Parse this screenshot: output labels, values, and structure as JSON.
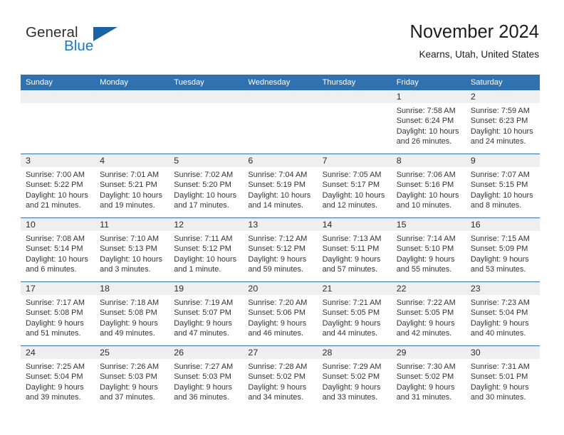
{
  "brand": {
    "name_part1": "General",
    "name_part2": "Blue",
    "triangle_color": "#1763a5",
    "blue_color": "#1a7ac4"
  },
  "header": {
    "title": "November 2024",
    "location": "Kearns, Utah, United States",
    "header_bg_color": "#3071b0",
    "daynum_band_color": "#efefef"
  },
  "weekday_headers": [
    "Sunday",
    "Monday",
    "Tuesday",
    "Wednesday",
    "Thursday",
    "Friday",
    "Saturday"
  ],
  "weeks": [
    {
      "days": [
        {
          "num": "",
          "empty": true,
          "sunrise": "",
          "sunset": "",
          "daylight_line1": "",
          "daylight_line2": ""
        },
        {
          "num": "",
          "empty": true,
          "sunrise": "",
          "sunset": "",
          "daylight_line1": "",
          "daylight_line2": ""
        },
        {
          "num": "",
          "empty": true,
          "sunrise": "",
          "sunset": "",
          "daylight_line1": "",
          "daylight_line2": ""
        },
        {
          "num": "",
          "empty": true,
          "sunrise": "",
          "sunset": "",
          "daylight_line1": "",
          "daylight_line2": ""
        },
        {
          "num": "",
          "empty": true,
          "sunrise": "",
          "sunset": "",
          "daylight_line1": "",
          "daylight_line2": ""
        },
        {
          "num": "1",
          "empty": false,
          "sunrise": "Sunrise: 7:58 AM",
          "sunset": "Sunset: 6:24 PM",
          "daylight_line1": "Daylight: 10 hours",
          "daylight_line2": "and 26 minutes."
        },
        {
          "num": "2",
          "empty": false,
          "sunrise": "Sunrise: 7:59 AM",
          "sunset": "Sunset: 6:23 PM",
          "daylight_line1": "Daylight: 10 hours",
          "daylight_line2": "and 24 minutes."
        }
      ]
    },
    {
      "days": [
        {
          "num": "3",
          "empty": false,
          "sunrise": "Sunrise: 7:00 AM",
          "sunset": "Sunset: 5:22 PM",
          "daylight_line1": "Daylight: 10 hours",
          "daylight_line2": "and 21 minutes."
        },
        {
          "num": "4",
          "empty": false,
          "sunrise": "Sunrise: 7:01 AM",
          "sunset": "Sunset: 5:21 PM",
          "daylight_line1": "Daylight: 10 hours",
          "daylight_line2": "and 19 minutes."
        },
        {
          "num": "5",
          "empty": false,
          "sunrise": "Sunrise: 7:02 AM",
          "sunset": "Sunset: 5:20 PM",
          "daylight_line1": "Daylight: 10 hours",
          "daylight_line2": "and 17 minutes."
        },
        {
          "num": "6",
          "empty": false,
          "sunrise": "Sunrise: 7:04 AM",
          "sunset": "Sunset: 5:19 PM",
          "daylight_line1": "Daylight: 10 hours",
          "daylight_line2": "and 14 minutes."
        },
        {
          "num": "7",
          "empty": false,
          "sunrise": "Sunrise: 7:05 AM",
          "sunset": "Sunset: 5:17 PM",
          "daylight_line1": "Daylight: 10 hours",
          "daylight_line2": "and 12 minutes."
        },
        {
          "num": "8",
          "empty": false,
          "sunrise": "Sunrise: 7:06 AM",
          "sunset": "Sunset: 5:16 PM",
          "daylight_line1": "Daylight: 10 hours",
          "daylight_line2": "and 10 minutes."
        },
        {
          "num": "9",
          "empty": false,
          "sunrise": "Sunrise: 7:07 AM",
          "sunset": "Sunset: 5:15 PM",
          "daylight_line1": "Daylight: 10 hours",
          "daylight_line2": "and 8 minutes."
        }
      ]
    },
    {
      "days": [
        {
          "num": "10",
          "empty": false,
          "sunrise": "Sunrise: 7:08 AM",
          "sunset": "Sunset: 5:14 PM",
          "daylight_line1": "Daylight: 10 hours",
          "daylight_line2": "and 6 minutes."
        },
        {
          "num": "11",
          "empty": false,
          "sunrise": "Sunrise: 7:10 AM",
          "sunset": "Sunset: 5:13 PM",
          "daylight_line1": "Daylight: 10 hours",
          "daylight_line2": "and 3 minutes."
        },
        {
          "num": "12",
          "empty": false,
          "sunrise": "Sunrise: 7:11 AM",
          "sunset": "Sunset: 5:12 PM",
          "daylight_line1": "Daylight: 10 hours",
          "daylight_line2": "and 1 minute."
        },
        {
          "num": "13",
          "empty": false,
          "sunrise": "Sunrise: 7:12 AM",
          "sunset": "Sunset: 5:12 PM",
          "daylight_line1": "Daylight: 9 hours",
          "daylight_line2": "and 59 minutes."
        },
        {
          "num": "14",
          "empty": false,
          "sunrise": "Sunrise: 7:13 AM",
          "sunset": "Sunset: 5:11 PM",
          "daylight_line1": "Daylight: 9 hours",
          "daylight_line2": "and 57 minutes."
        },
        {
          "num": "15",
          "empty": false,
          "sunrise": "Sunrise: 7:14 AM",
          "sunset": "Sunset: 5:10 PM",
          "daylight_line1": "Daylight: 9 hours",
          "daylight_line2": "and 55 minutes."
        },
        {
          "num": "16",
          "empty": false,
          "sunrise": "Sunrise: 7:15 AM",
          "sunset": "Sunset: 5:09 PM",
          "daylight_line1": "Daylight: 9 hours",
          "daylight_line2": "and 53 minutes."
        }
      ]
    },
    {
      "days": [
        {
          "num": "17",
          "empty": false,
          "sunrise": "Sunrise: 7:17 AM",
          "sunset": "Sunset: 5:08 PM",
          "daylight_line1": "Daylight: 9 hours",
          "daylight_line2": "and 51 minutes."
        },
        {
          "num": "18",
          "empty": false,
          "sunrise": "Sunrise: 7:18 AM",
          "sunset": "Sunset: 5:08 PM",
          "daylight_line1": "Daylight: 9 hours",
          "daylight_line2": "and 49 minutes."
        },
        {
          "num": "19",
          "empty": false,
          "sunrise": "Sunrise: 7:19 AM",
          "sunset": "Sunset: 5:07 PM",
          "daylight_line1": "Daylight: 9 hours",
          "daylight_line2": "and 47 minutes."
        },
        {
          "num": "20",
          "empty": false,
          "sunrise": "Sunrise: 7:20 AM",
          "sunset": "Sunset: 5:06 PM",
          "daylight_line1": "Daylight: 9 hours",
          "daylight_line2": "and 46 minutes."
        },
        {
          "num": "21",
          "empty": false,
          "sunrise": "Sunrise: 7:21 AM",
          "sunset": "Sunset: 5:05 PM",
          "daylight_line1": "Daylight: 9 hours",
          "daylight_line2": "and 44 minutes."
        },
        {
          "num": "22",
          "empty": false,
          "sunrise": "Sunrise: 7:22 AM",
          "sunset": "Sunset: 5:05 PM",
          "daylight_line1": "Daylight: 9 hours",
          "daylight_line2": "and 42 minutes."
        },
        {
          "num": "23",
          "empty": false,
          "sunrise": "Sunrise: 7:23 AM",
          "sunset": "Sunset: 5:04 PM",
          "daylight_line1": "Daylight: 9 hours",
          "daylight_line2": "and 40 minutes."
        }
      ]
    },
    {
      "days": [
        {
          "num": "24",
          "empty": false,
          "sunrise": "Sunrise: 7:25 AM",
          "sunset": "Sunset: 5:04 PM",
          "daylight_line1": "Daylight: 9 hours",
          "daylight_line2": "and 39 minutes."
        },
        {
          "num": "25",
          "empty": false,
          "sunrise": "Sunrise: 7:26 AM",
          "sunset": "Sunset: 5:03 PM",
          "daylight_line1": "Daylight: 9 hours",
          "daylight_line2": "and 37 minutes."
        },
        {
          "num": "26",
          "empty": false,
          "sunrise": "Sunrise: 7:27 AM",
          "sunset": "Sunset: 5:03 PM",
          "daylight_line1": "Daylight: 9 hours",
          "daylight_line2": "and 36 minutes."
        },
        {
          "num": "27",
          "empty": false,
          "sunrise": "Sunrise: 7:28 AM",
          "sunset": "Sunset: 5:02 PM",
          "daylight_line1": "Daylight: 9 hours",
          "daylight_line2": "and 34 minutes."
        },
        {
          "num": "28",
          "empty": false,
          "sunrise": "Sunrise: 7:29 AM",
          "sunset": "Sunset: 5:02 PM",
          "daylight_line1": "Daylight: 9 hours",
          "daylight_line2": "and 33 minutes."
        },
        {
          "num": "29",
          "empty": false,
          "sunrise": "Sunrise: 7:30 AM",
          "sunset": "Sunset: 5:02 PM",
          "daylight_line1": "Daylight: 9 hours",
          "daylight_line2": "and 31 minutes."
        },
        {
          "num": "30",
          "empty": false,
          "sunrise": "Sunrise: 7:31 AM",
          "sunset": "Sunset: 5:01 PM",
          "daylight_line1": "Daylight: 9 hours",
          "daylight_line2": "and 30 minutes."
        }
      ]
    }
  ]
}
